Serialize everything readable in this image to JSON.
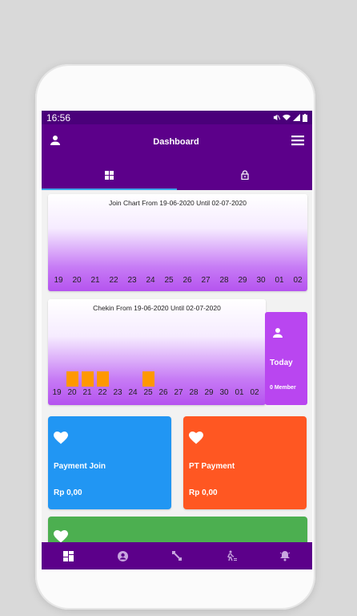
{
  "status_bar": {
    "time": "16:56"
  },
  "app_bar": {
    "title": "Dashboard"
  },
  "join_chart": {
    "title": "Join Chart From 19-06-2020 Until 02-07-2020",
    "x_labels": [
      "19",
      "20",
      "21",
      "22",
      "23",
      "24",
      "25",
      "26",
      "27",
      "28",
      "29",
      "30",
      "01",
      "02"
    ]
  },
  "chekin_chart": {
    "title": "Chekin From 19-06-2020 Until 02-07-2020",
    "x_labels": [
      "19",
      "20",
      "21",
      "22",
      "23",
      "24",
      "25",
      "26",
      "27",
      "28",
      "29",
      "30",
      "01",
      "02"
    ]
  },
  "chart_data": [
    {
      "type": "bar",
      "title": "Join Chart From 19-06-2020 Until 02-07-2020",
      "categories": [
        "19",
        "20",
        "21",
        "22",
        "23",
        "24",
        "25",
        "26",
        "27",
        "28",
        "29",
        "30",
        "01",
        "02"
      ],
      "values": [
        0,
        0,
        0,
        0,
        0,
        0,
        0,
        0,
        0,
        0,
        0,
        0,
        0,
        0
      ],
      "colors": {
        "bar": "#ff9800"
      }
    },
    {
      "type": "bar",
      "title": "Chekin From 19-06-2020 Until 02-07-2020",
      "categories": [
        "19",
        "20",
        "21",
        "22",
        "23",
        "24",
        "25",
        "26",
        "27",
        "28",
        "29",
        "30",
        "01",
        "02"
      ],
      "values": [
        0,
        1,
        1,
        1,
        0,
        0,
        1,
        0,
        0,
        0,
        0,
        0,
        0,
        0
      ],
      "colors": {
        "bar": "#ff9800"
      }
    }
  ],
  "today_card": {
    "label": "Today",
    "count": "0 Member"
  },
  "tiles": {
    "payment_join": {
      "title": "Payment Join",
      "amount": "Rp  0,00",
      "color": "#2196f3"
    },
    "pt_payment": {
      "title": "PT Payment",
      "amount": "Rp  0,00",
      "color": "#ff5722"
    },
    "third": {
      "color": "#4caf50"
    }
  },
  "colors": {
    "primary": "#5c008a",
    "status_bar": "#4a007a",
    "accent": "#3ba4e8",
    "today": "#b946f0"
  },
  "icons": {
    "app_bar": [
      "person-icon",
      "menu-icon"
    ],
    "tabs": [
      "dashboard-icon",
      "lock-icon"
    ],
    "bottom_nav": [
      "dashboard-icon",
      "account-circle-icon",
      "fitness-icon",
      "person-walking-icon",
      "notification-bell-icon"
    ]
  }
}
